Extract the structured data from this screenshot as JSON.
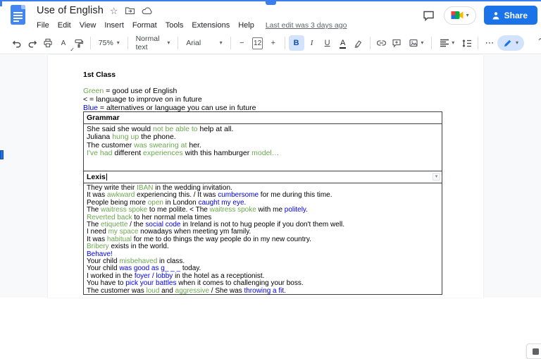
{
  "colors": {
    "green": "#6aa84f",
    "blue": "#0000ee",
    "accent_blue": "#1a73e8",
    "icon_grey": "#5f6368"
  },
  "header": {
    "doc_title": "Use of English",
    "menu_items": [
      "File",
      "Edit",
      "View",
      "Insert",
      "Format",
      "Tools",
      "Extensions",
      "Help"
    ],
    "last_edit": "Last edit was 3 days ago",
    "share_label": "Share"
  },
  "toolbar": {
    "zoom_value": "75%",
    "paragraph_style": "Normal text",
    "font_name": "Arial",
    "font_size": "12",
    "bold": "B",
    "italic": "I",
    "underline": "U",
    "text_color": "A",
    "spellcheck_letter": "A",
    "spellcheck_check": "✓",
    "minus": "−",
    "plus": "+",
    "more": "⋯"
  },
  "doc": {
    "heading": "1st Class",
    "legend": [
      [
        {
          "t": "Green",
          "c": "green"
        },
        {
          "t": " = good use of English"
        }
      ],
      [
        {
          "t": "< = language to improve on in future"
        }
      ],
      [
        {
          "t": "Blue",
          "c": "blue"
        },
        {
          "t": " = alternatives or language you can use in future"
        }
      ]
    ],
    "grammar_header": "Grammar",
    "grammar_lines": [
      [
        {
          "t": "She said she would "
        },
        {
          "t": "not be able to",
          "c": "green"
        },
        {
          "t": " help at all."
        }
      ],
      [
        {
          "t": "Juliana "
        },
        {
          "t": "hung up",
          "c": "green"
        },
        {
          "t": " the phone."
        }
      ],
      [
        {
          "t": "The customer "
        },
        {
          "t": "was swearing at",
          "c": "green"
        },
        {
          "t": " her."
        }
      ],
      [
        {
          "t": "I've had",
          "c": "green"
        },
        {
          "t": " different "
        },
        {
          "t": "experiences",
          "c": "green"
        },
        {
          "t": " with this hamburger "
        },
        {
          "t": "model…",
          "c": "green"
        }
      ]
    ],
    "lexis_header": "Lexis",
    "lexis_lines": [
      [
        {
          "t": "They write their "
        },
        {
          "t": "IBAN",
          "c": "green"
        },
        {
          "t": " in the wedding invitation."
        }
      ],
      [
        {
          "t": "It was "
        },
        {
          "t": "awkward",
          "c": "green"
        },
        {
          "t": " experiencing this. / It was "
        },
        {
          "t": "cumbersome",
          "c": "blue"
        },
        {
          "t": " for me during this time."
        }
      ],
      [
        {
          "t": "People being more "
        },
        {
          "t": "open",
          "c": "green"
        },
        {
          "t": " in London "
        },
        {
          "t": "caught my eye.",
          "c": "blue"
        }
      ],
      [
        {
          "t": "The "
        },
        {
          "t": "waitress spoke",
          "c": "green"
        },
        {
          "t": " to me polite. < The "
        },
        {
          "t": "waitress spoke",
          "c": "green"
        },
        {
          "t": " with me "
        },
        {
          "t": "politely.",
          "c": "blue"
        }
      ],
      [
        {
          "t": "Reverted back",
          "c": "green"
        },
        {
          "t": " to her normal mela times"
        }
      ],
      [
        {
          "t": "The "
        },
        {
          "t": "etiquette",
          "c": "green"
        },
        {
          "t": " / the "
        },
        {
          "t": "social code",
          "c": "blue"
        },
        {
          "t": " in Ireland is not to hug people if you don't them well."
        }
      ],
      [
        {
          "t": "I need "
        },
        {
          "t": "my space",
          "c": "green"
        },
        {
          "t": " nowadays when meeting ym family."
        }
      ],
      [
        {
          "t": "It was "
        },
        {
          "t": "habitual",
          "c": "green"
        },
        {
          "t": " for me to do things the way people do in my new country."
        }
      ],
      [
        {
          "t": "Bribery",
          "c": "green"
        },
        {
          "t": " exists in the world."
        }
      ],
      [
        {
          "t": "Behave!",
          "c": "blue"
        }
      ],
      [
        {
          "t": "Your child "
        },
        {
          "t": "misbehaved",
          "c": "green"
        },
        {
          "t": " in class."
        }
      ],
      [
        {
          "t": "Your child "
        },
        {
          "t": "was good as g_ _ _",
          "c": "blue"
        },
        {
          "t": " today."
        }
      ],
      [
        {
          "t": "I worked in the "
        },
        {
          "t": "foyer / lobby",
          "c": "blue"
        },
        {
          "t": " in the hotel as a receptionist."
        }
      ],
      [
        {
          "t": "You have to "
        },
        {
          "t": "pick your battles",
          "c": "blue"
        },
        {
          "t": " when it comes to challenging your boss."
        }
      ],
      [
        {
          "t": "The customer was "
        },
        {
          "t": "loud",
          "c": "green"
        },
        {
          "t": " and "
        },
        {
          "t": "aggressive",
          "c": "green"
        },
        {
          "t": " / She was "
        },
        {
          "t": "throwing a fit.",
          "c": "blue"
        }
      ]
    ]
  }
}
